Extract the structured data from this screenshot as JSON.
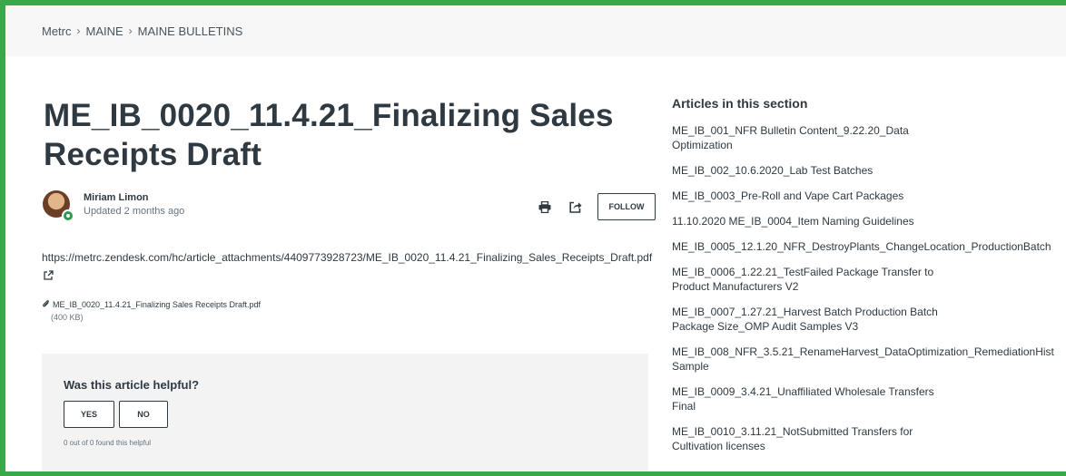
{
  "breadcrumb": [
    {
      "label": "Metrc"
    },
    {
      "label": "MAINE"
    },
    {
      "label": "MAINE BULLETINS"
    }
  ],
  "breadcrumb_separator": "›",
  "article": {
    "title": "ME_IB_0020_11.4.21_Finalizing Sales Receipts Draft",
    "author": "Miriam Limon",
    "updated": "Updated 2 months ago",
    "follow_label": "FOLLOW",
    "link": "https://metrc.zendesk.com/hc/article_attachments/4409773928723/ME_IB_0020_11.4.21_Finalizing_Sales_Receipts_Draft.pdf",
    "attachment_name": "ME_IB_0020_11.4.21_Finalizing Sales Receipts Draft.pdf",
    "attachment_size": "(400 KB)"
  },
  "feedback": {
    "question": "Was this article helpful?",
    "yes_label": "YES",
    "no_label": "NO",
    "count_text": "0 out of 0 found this helpful"
  },
  "sidebar": {
    "title": "Articles in this section",
    "items": [
      {
        "lines": [
          "ME_IB_001_NFR Bulletin Content_9.22.20_Data",
          "Optimization"
        ]
      },
      {
        "lines": [
          "ME_IB_002_10.6.2020_Lab Test Batches"
        ]
      },
      {
        "lines": [
          "ME_IB_0003_Pre-Roll and Vape Cart Packages"
        ]
      },
      {
        "lines": [
          "11.10.2020 ME_IB_0004_Item Naming Guidelines"
        ]
      },
      {
        "lines": [
          "ME_IB_0005_12.1.20_NFR_DestroyPlants_ChangeLocation_ProductionBatch"
        ]
      },
      {
        "lines": [
          "ME_IB_0006_1.22.21_TestFailed Package Transfer to",
          "Product Manufacturers V2"
        ]
      },
      {
        "lines": [
          "ME_IB_0007_1.27.21_Harvest Batch Production Batch",
          "Package Size_OMP Audit Samples V3"
        ]
      },
      {
        "lines": [
          "ME_IB_008_NFR_3.5.21_RenameHarvest_DataOptimization_RemediationHist",
          "Sample"
        ]
      },
      {
        "lines": [
          "ME_IB_0009_3.4.21_Unaffiliated Wholesale Transfers",
          "Final"
        ]
      },
      {
        "lines": [
          "ME_IB_0010_3.11.21_NotSubmitted Transfers for",
          "Cultivation licenses"
        ]
      }
    ]
  },
  "colors": {
    "frame_border": "#3aa84a",
    "text": "#2f3941",
    "muted": "#68737d",
    "panel": "#f3f3f3",
    "breadcrumb_bg": "#f7f7f7"
  },
  "icons": {
    "print": "print-icon",
    "share": "share-icon",
    "external": "external-link-icon",
    "attachment": "paperclip-icon",
    "author_badge": "agent-badge-icon"
  }
}
